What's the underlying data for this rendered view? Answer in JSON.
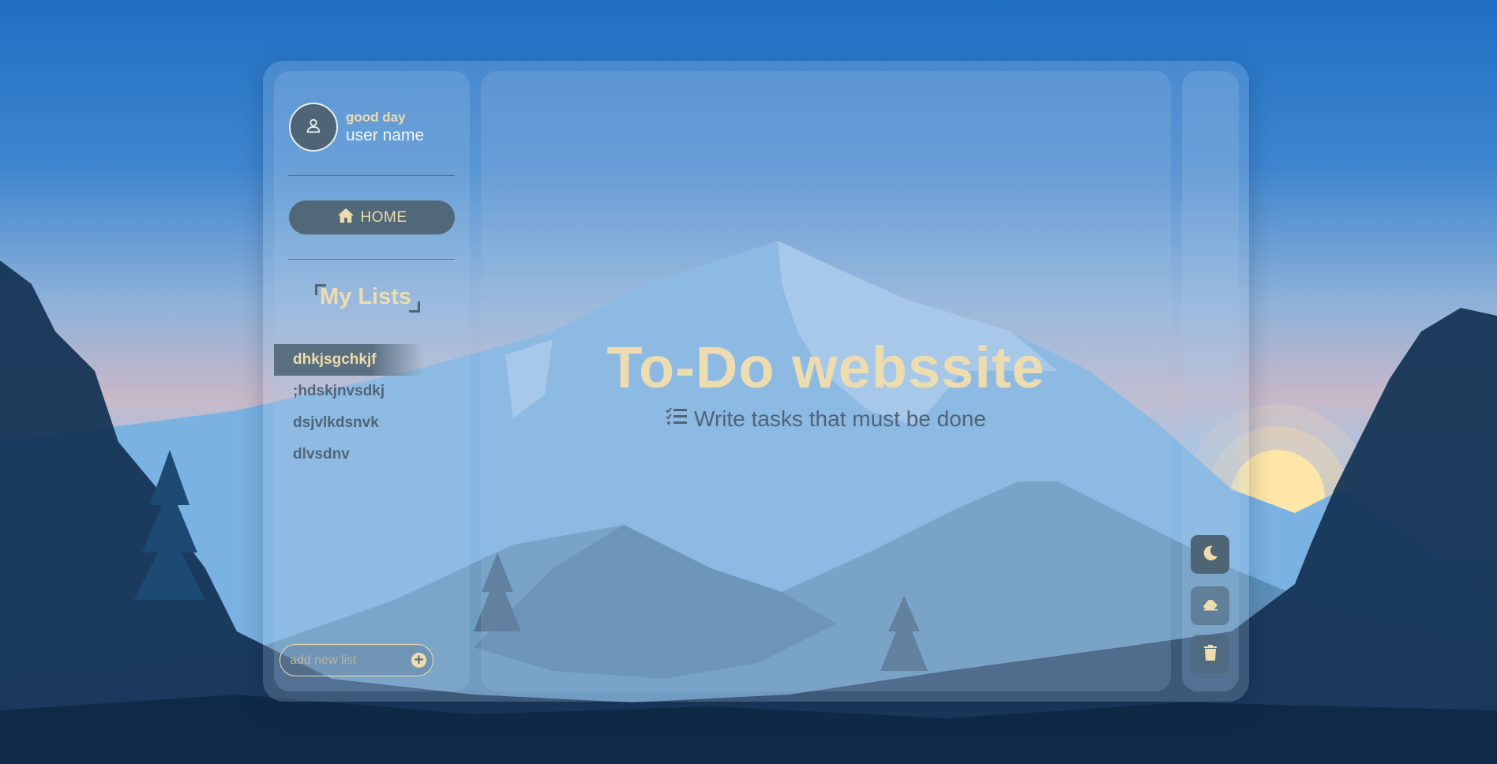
{
  "profile": {
    "greeting": "good day",
    "username": "user name"
  },
  "nav": {
    "home_label": "HOME"
  },
  "lists": {
    "heading": "My Lists",
    "items": [
      {
        "label": "dhkjsgchkjf",
        "active": true
      },
      {
        "label": ";hdskjnvsdkj",
        "active": false
      },
      {
        "label": "dsjvlkdsnvk",
        "active": false
      },
      {
        "label": "dlvsdnv",
        "active": false
      }
    ],
    "add_placeholder": "add new list"
  },
  "main": {
    "title": "To-Do webssite",
    "subtitle": "Write tasks that must be done"
  },
  "tools": {
    "icons": [
      "moon-icon",
      "eraser-icon",
      "trash-icon"
    ]
  },
  "colors": {
    "accent": "#efdcae",
    "slate": "#4f6576"
  }
}
